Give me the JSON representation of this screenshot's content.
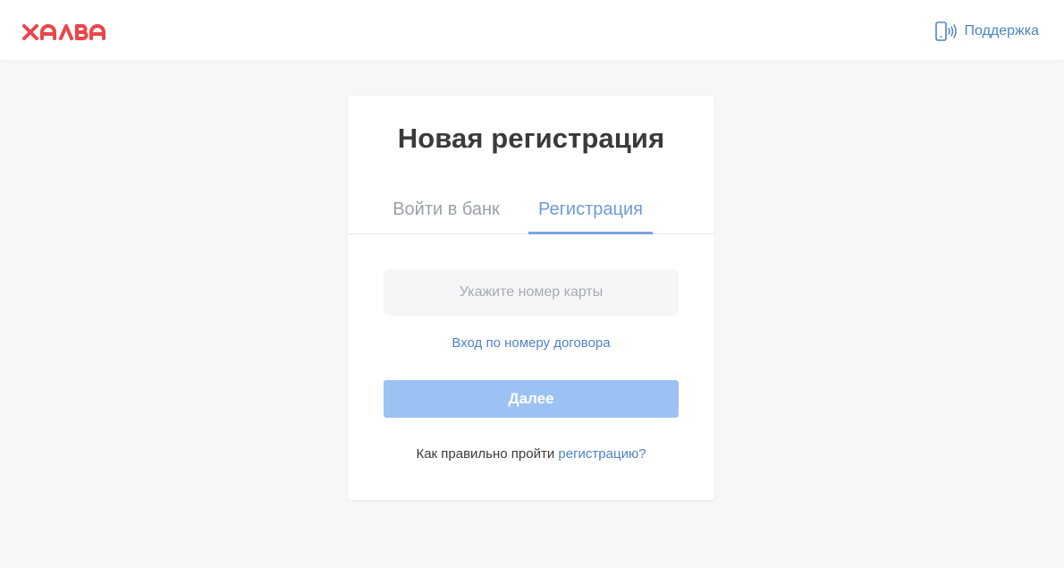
{
  "header": {
    "logo_text": "ХАЛВА",
    "support_label": "Поддержка",
    "support_icon": "phone-signal-icon"
  },
  "card": {
    "title": "Новая регистрация",
    "tabs": [
      {
        "label": "Войти в банк",
        "active": false
      },
      {
        "label": "Регистрация",
        "active": true
      }
    ],
    "card_input": {
      "placeholder": "Укажите номер карты",
      "value": ""
    },
    "contract_link": "Вход по номеру договора",
    "next_button": "Далее",
    "help_text": "Как правильно пройти",
    "help_link": "регистрацию?"
  },
  "colors": {
    "brand": "#e8474b",
    "link": "#4f83c5",
    "active_tab": "#6e9bd6",
    "button": "#9cc2f3",
    "background": "#f7f7f7"
  }
}
